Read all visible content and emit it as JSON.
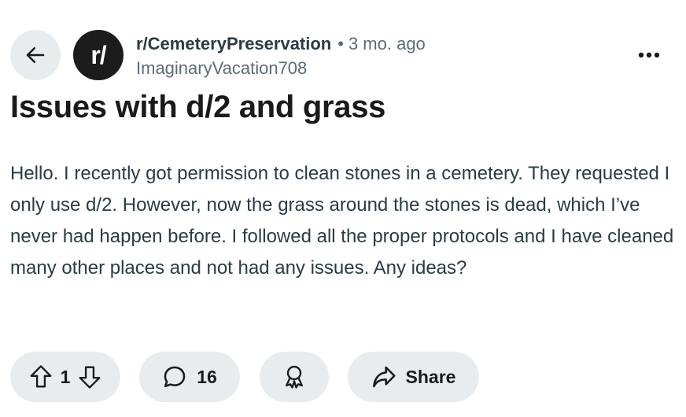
{
  "header": {
    "avatar_text": "r/",
    "subreddit": "r/CemeteryPreservation",
    "separator": "•",
    "age": "3 mo. ago",
    "author": "ImaginaryVacation708"
  },
  "post": {
    "title": "Issues with d/2 and grass",
    "body": "Hello. I recently got permission to clean stones in a cemetery. They requested I only use d/2. However, now the grass around the stones is dead, which I’ve never had happen before. I followed all the proper protocols and I have cleaned many other places and not had any issues. Any ideas?"
  },
  "actions": {
    "vote_count": "1",
    "comment_count": "16",
    "share_label": "Share"
  },
  "icons": {
    "back": "arrow-left-icon",
    "menu": "more-horizontal-icon",
    "upvote": "upvote-arrow-icon",
    "downvote": "downvote-arrow-icon",
    "comment": "speech-bubble-icon",
    "award": "award-ribbon-icon",
    "share": "share-arrow-icon"
  },
  "colors": {
    "pill_background": "#e9ecef",
    "avatar_background": "#1c1c1c",
    "meta_text": "#5c6c74",
    "body_text": "#2a3c42"
  }
}
